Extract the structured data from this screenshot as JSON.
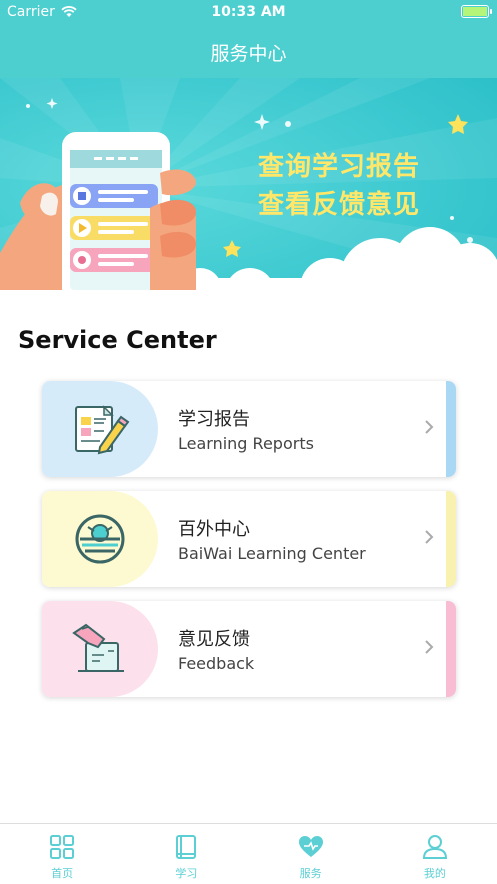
{
  "status": {
    "carrier": "Carrier",
    "time": "10:33 AM",
    "battery_level": 1.0
  },
  "nav": {
    "title": "服务中心"
  },
  "banner": {
    "line1": "查询学习报告",
    "line2": "查看反馈意见"
  },
  "section": {
    "title": "Service Center"
  },
  "cards": [
    {
      "title": "学习报告",
      "subtitle": "Learning Reports",
      "icon": "document-pencil-icon",
      "blob_color": "#d6ebfa",
      "stripe_color": "#a9d8f5"
    },
    {
      "title": "百外中心",
      "subtitle": "BaiWai Learning Center",
      "icon": "baiwai-logo-icon",
      "blob_color": "#fdf9d0",
      "stripe_color": "#f8f1b0"
    },
    {
      "title": "意见反馈",
      "subtitle": "Feedback",
      "icon": "feedback-hand-icon",
      "blob_color": "#fce1ec",
      "stripe_color": "#f8bcd3"
    }
  ],
  "tabs": [
    {
      "label": "首页",
      "icon": "grid-icon",
      "active": false
    },
    {
      "label": "学习",
      "icon": "book-icon",
      "active": false
    },
    {
      "label": "服务",
      "icon": "heart-icon",
      "active": true
    },
    {
      "label": "我的",
      "icon": "person-icon",
      "active": false
    }
  ],
  "colors": {
    "accent": "#4dcfd0",
    "banner_text": "#ffe76a"
  }
}
